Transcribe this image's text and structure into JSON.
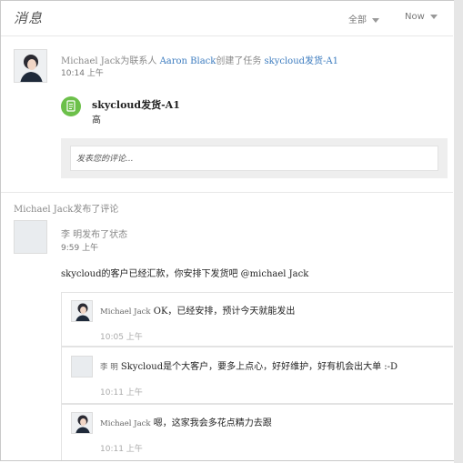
{
  "header": {
    "title": "消息",
    "filter_all": "全部",
    "filter_time": "Now"
  },
  "task_activity": {
    "actor": "Michael Jack",
    "text_1": "为联系人",
    "contact": "Aaron Black",
    "text_2": "创建了任务",
    "task_link": "skycloud发货-A1",
    "time": "10:14 上午",
    "task_title": "skycloud发货-A1",
    "task_priority": "高",
    "comment_placeholder": "发表您的评论..."
  },
  "comment_activity": {
    "heading": "Michael Jack发布了评论",
    "status_author": "李 明发布了状态",
    "status_time": "9:59 上午",
    "status_text": "skycloud的客户已经汇款，你安排下发货吧 @michael Jack"
  },
  "replies": [
    {
      "name": "Michael Jack",
      "text": "OK，已经安排，预计今天就能发出",
      "time": "10:05 上午"
    },
    {
      "name": "李 明",
      "text": "Skycloud是个大客户，要多上点心，好好维护，好有机会出大单 :-D",
      "time": "10:11 上午"
    },
    {
      "name": "Michael Jack",
      "text": "嗯，这家我会多花点精力去跟",
      "time": "10:11 上午"
    }
  ],
  "colors": {
    "link": "#3b7bbf",
    "task_icon": "#6cc04a"
  }
}
